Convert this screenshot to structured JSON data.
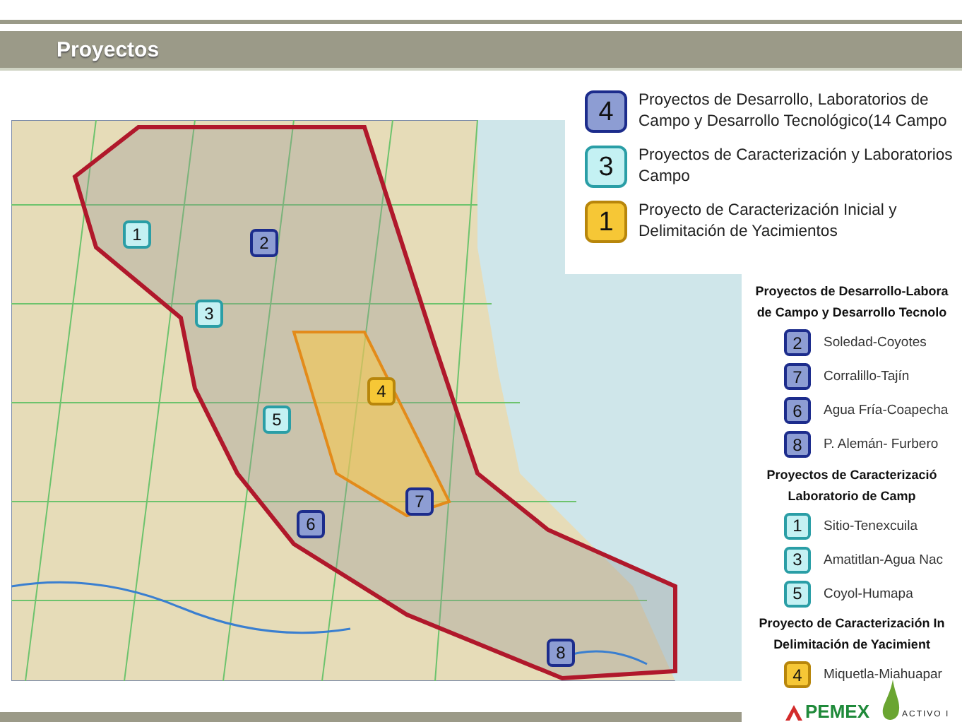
{
  "header": {
    "title": "Proyectos"
  },
  "map": {
    "markers": [
      {
        "number": "1",
        "kind": "characterization"
      },
      {
        "number": "2",
        "kind": "development"
      },
      {
        "number": "3",
        "kind": "characterization"
      },
      {
        "number": "4",
        "kind": "initial"
      },
      {
        "number": "5",
        "kind": "characterization"
      },
      {
        "number": "6",
        "kind": "development"
      },
      {
        "number": "7",
        "kind": "development"
      },
      {
        "number": "8",
        "kind": "development"
      }
    ]
  },
  "legend": [
    {
      "number": "4",
      "kind": "development",
      "text": "Proyectos de Desarrollo, Laboratorios de Campo y Desarrollo Tecnológico(14 Campo"
    },
    {
      "number": "3",
      "kind": "characterization",
      "text": "Proyectos de Caracterización y Laboratorios Campo"
    },
    {
      "number": "1",
      "kind": "initial",
      "text": "Proyecto de Caracterización Inicial y Delimitación de Yacimientos"
    }
  ],
  "project_groups": [
    {
      "kind": "development",
      "heading": [
        "Proyectos de Desarrollo-Labora",
        "de Campo y Desarrollo Tecnolo"
      ],
      "items": [
        {
          "number": "2",
          "name": "Soledad-Coyotes"
        },
        {
          "number": "7",
          "name": "Corralillo-Tajín"
        },
        {
          "number": "6",
          "name": "Agua Fría-Coapecha"
        },
        {
          "number": "8",
          "name": "P. Alemán- Furbero"
        }
      ]
    },
    {
      "kind": "characterization",
      "heading": [
        "Proyectos de Caracterizació",
        "Laboratorio de Camp"
      ],
      "items": [
        {
          "number": "1",
          "name": "Sitio-Tenexcuila"
        },
        {
          "number": "3",
          "name": "Amatitlan-Agua Nac"
        },
        {
          "number": "5",
          "name": "Coyol-Humapa"
        }
      ]
    },
    {
      "kind": "initial",
      "heading": [
        "Proyecto de Caracterización In",
        "Delimitación de Yacimient"
      ],
      "items": [
        {
          "number": "4",
          "name": "Miquetla-Miahuapar"
        }
      ]
    }
  ],
  "footer": {
    "logos": [
      {
        "kind": "pemex",
        "text": "PEMEX"
      },
      {
        "kind": "activo",
        "text": "ACTIVO I"
      }
    ]
  }
}
